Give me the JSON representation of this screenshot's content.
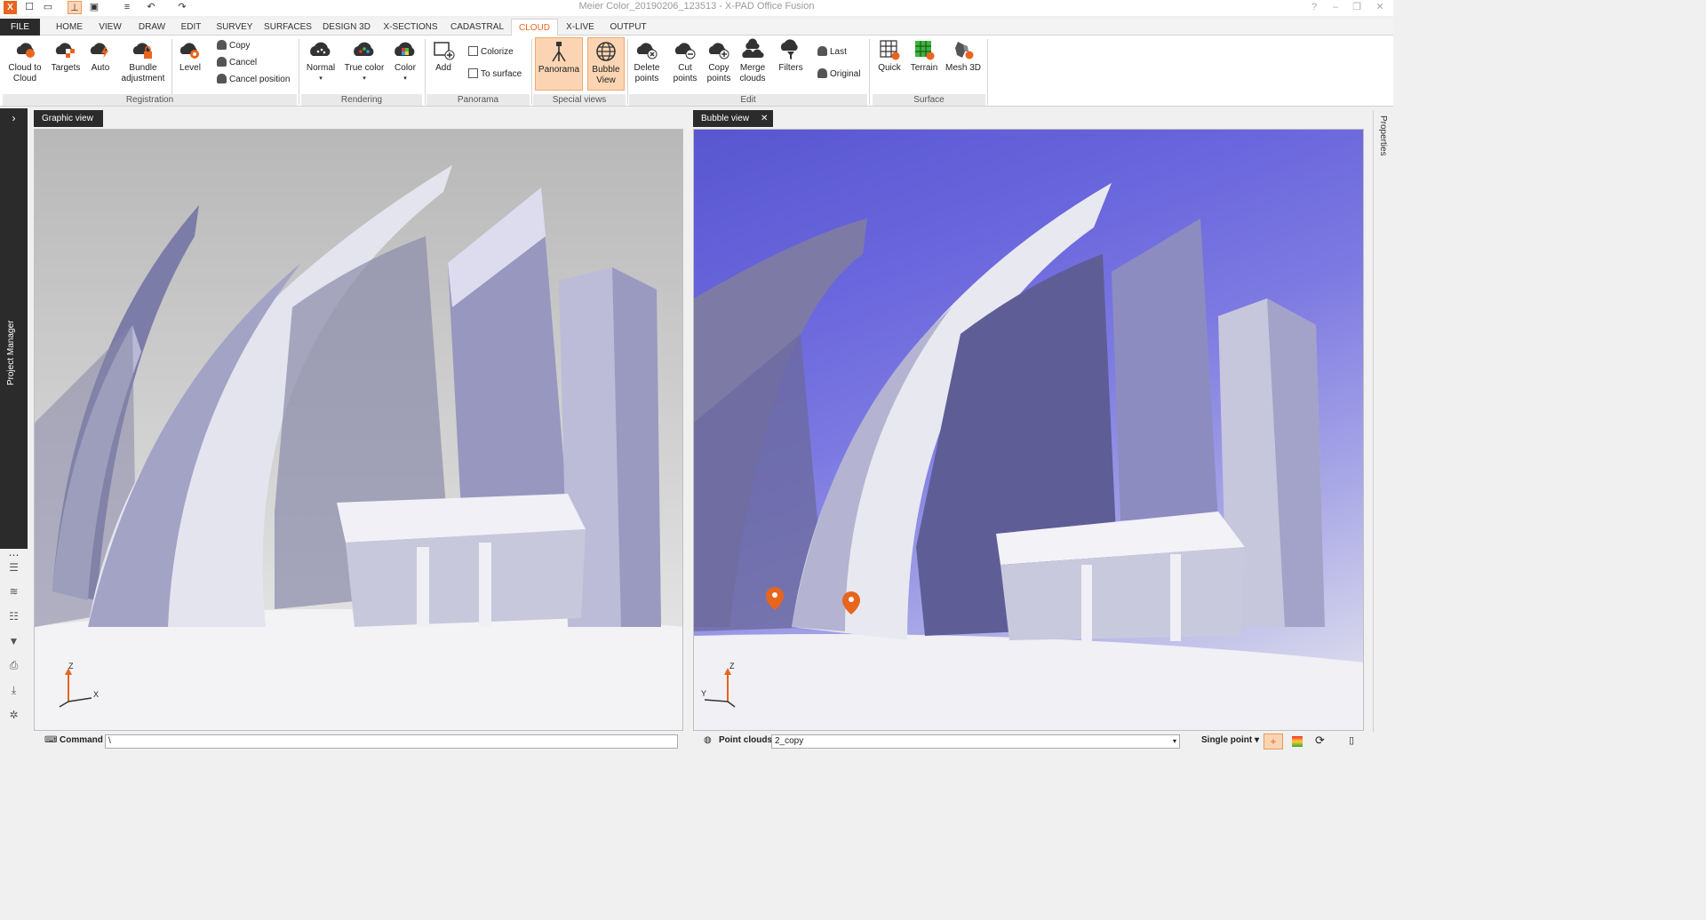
{
  "window": {
    "title": "Meier Color_20190206_123513 - X-PAD Office Fusion",
    "app_icon": "X"
  },
  "ribbon_tabs": [
    "FILE",
    "HOME",
    "VIEW",
    "DRAW",
    "EDIT",
    "SURVEY",
    "SURFACES",
    "DESIGN 3D",
    "X-SECTIONS",
    "CADASTRAL",
    "CLOUD",
    "X-LIVE",
    "OUTPUT"
  ],
  "active_tab": "CLOUD",
  "ribbon": {
    "registration": {
      "label": "Registration",
      "cloud_to_cloud": "Cloud to Cloud",
      "targets": "Targets",
      "auto": "Auto",
      "bundle_adjustment": "Bundle adjustment",
      "level": "Level",
      "copy": "Copy",
      "cancel": "Cancel",
      "cancel_position": "Cancel position"
    },
    "rendering": {
      "label": "Rendering",
      "normal": "Normal",
      "true_color": "True color",
      "color": "Color"
    },
    "panorama": {
      "label": "Panorama",
      "add": "Add",
      "colorize": "Colorize",
      "to_surface": "To surface"
    },
    "special_views": {
      "label": "Special views",
      "panorama": "Panorama",
      "bubble_view": "Bubble View"
    },
    "edit": {
      "label": "Edit",
      "delete_points": "Delete points",
      "cut_points": "Cut points",
      "copy_points": "Copy points",
      "merge_clouds": "Merge clouds",
      "filters": "Filters",
      "last": "Last",
      "original": "Original"
    },
    "surface": {
      "label": "Surface",
      "quick": "Quick",
      "terrain": "Terrain",
      "mesh_3d": "Mesh 3D"
    }
  },
  "sidebar": {
    "project_manager": "Project Manager"
  },
  "graphic_view": {
    "tab": "Graphic view",
    "axis_z": "Z",
    "axis_x": "X"
  },
  "bubble_view": {
    "tab": "Bubble view",
    "axis_z": "Z",
    "axis_y": "Y"
  },
  "command_bar": {
    "label": "Command",
    "value": "\\"
  },
  "point_cloud_bar": {
    "label": "Point clouds",
    "selected": "2_copy",
    "mode": "Single point"
  },
  "properties_panel": {
    "label": "Properties"
  },
  "colors": {
    "accent": "#e8651e",
    "dark": "#2b2b2b",
    "active_fill": "#fbd5b3",
    "sky": "#5856d0"
  }
}
